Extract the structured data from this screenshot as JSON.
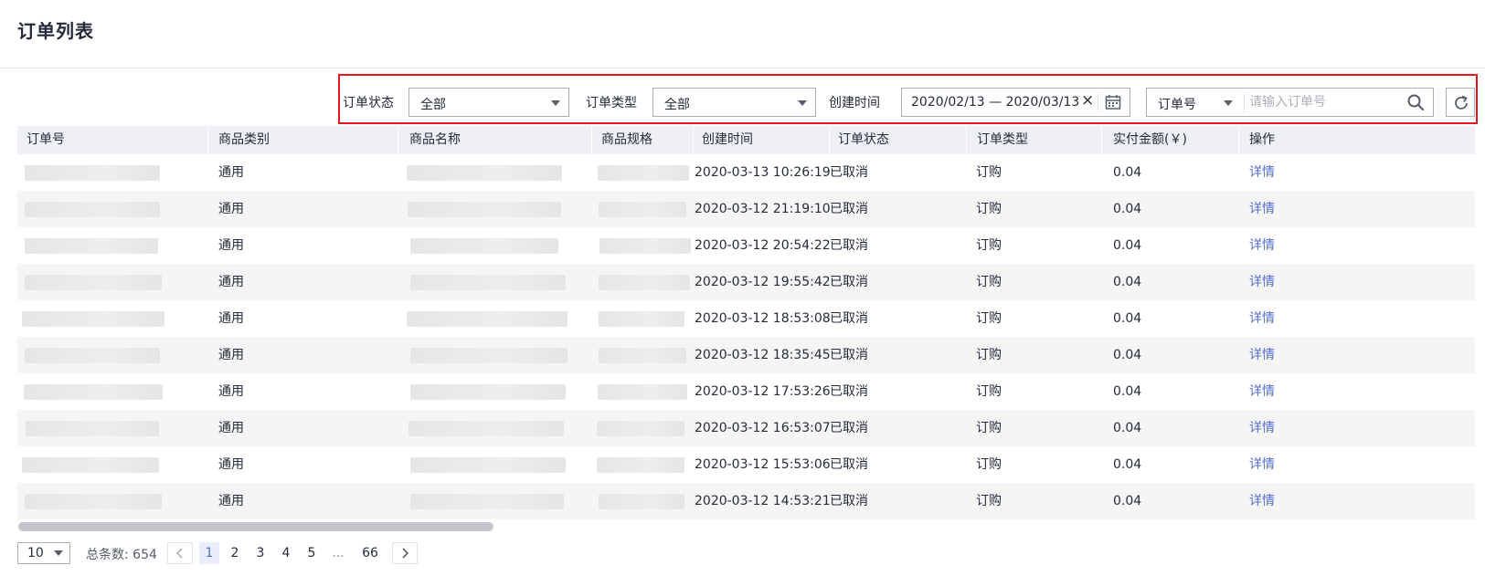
{
  "page": {
    "title": "订单列表"
  },
  "filters": {
    "status_label": "订单状态",
    "status_value": "全部",
    "type_label": "订单类型",
    "type_value": "全部",
    "date_label": "创建时间",
    "date_value": "2020/02/13 — 2020/03/13",
    "search_field": "订单号",
    "search_placeholder": "请输入订单号"
  },
  "table": {
    "columns": [
      "订单号",
      "商品类别",
      "商品名称",
      "商品规格",
      "创建时间",
      "订单状态",
      "订单类型",
      "实付金额(￥)",
      "操作"
    ],
    "rows": [
      {
        "category": "通用",
        "created": "2020-03-13 10:26:19",
        "status": "已取消",
        "type": "订购",
        "amount": "0.04",
        "action": "详情"
      },
      {
        "category": "通用",
        "created": "2020-03-12 21:19:10",
        "status": "已取消",
        "type": "订购",
        "amount": "0.04",
        "action": "详情"
      },
      {
        "category": "通用",
        "created": "2020-03-12 20:54:22",
        "status": "已取消",
        "type": "订购",
        "amount": "0.04",
        "action": "详情"
      },
      {
        "category": "通用",
        "created": "2020-03-12 19:55:42",
        "status": "已取消",
        "type": "订购",
        "amount": "0.04",
        "action": "详情"
      },
      {
        "category": "通用",
        "created": "2020-03-12 18:53:08",
        "status": "已取消",
        "type": "订购",
        "amount": "0.04",
        "action": "详情"
      },
      {
        "category": "通用",
        "created": "2020-03-12 18:35:45",
        "status": "已取消",
        "type": "订购",
        "amount": "0.04",
        "action": "详情"
      },
      {
        "category": "通用",
        "created": "2020-03-12 17:53:26",
        "status": "已取消",
        "type": "订购",
        "amount": "0.04",
        "action": "详情"
      },
      {
        "category": "通用",
        "created": "2020-03-12 16:53:07",
        "status": "已取消",
        "type": "订购",
        "amount": "0.04",
        "action": "详情"
      },
      {
        "category": "通用",
        "created": "2020-03-12 15:53:06",
        "status": "已取消",
        "type": "订购",
        "amount": "0.04",
        "action": "详情"
      },
      {
        "category": "通用",
        "created": "2020-03-12 14:53:21",
        "status": "已取消",
        "type": "订购",
        "amount": "0.04",
        "action": "详情"
      }
    ]
  },
  "pagination": {
    "page_size": "10",
    "total_label": "总条数: 654",
    "pages": [
      "1",
      "2",
      "3",
      "4",
      "5",
      "...",
      "66"
    ],
    "current": "1"
  },
  "icons": {
    "calendar": "calendar-icon",
    "clear": "clear-icon",
    "search": "search-icon",
    "refresh": "refresh-icon",
    "prev": "chevron-left-icon",
    "next": "chevron-right-icon"
  },
  "colors": {
    "highlight_frame": "#e4161b",
    "link": "#526ecc",
    "header_bg": "#eef0f5",
    "stripe_bg": "#f5f5f6"
  }
}
